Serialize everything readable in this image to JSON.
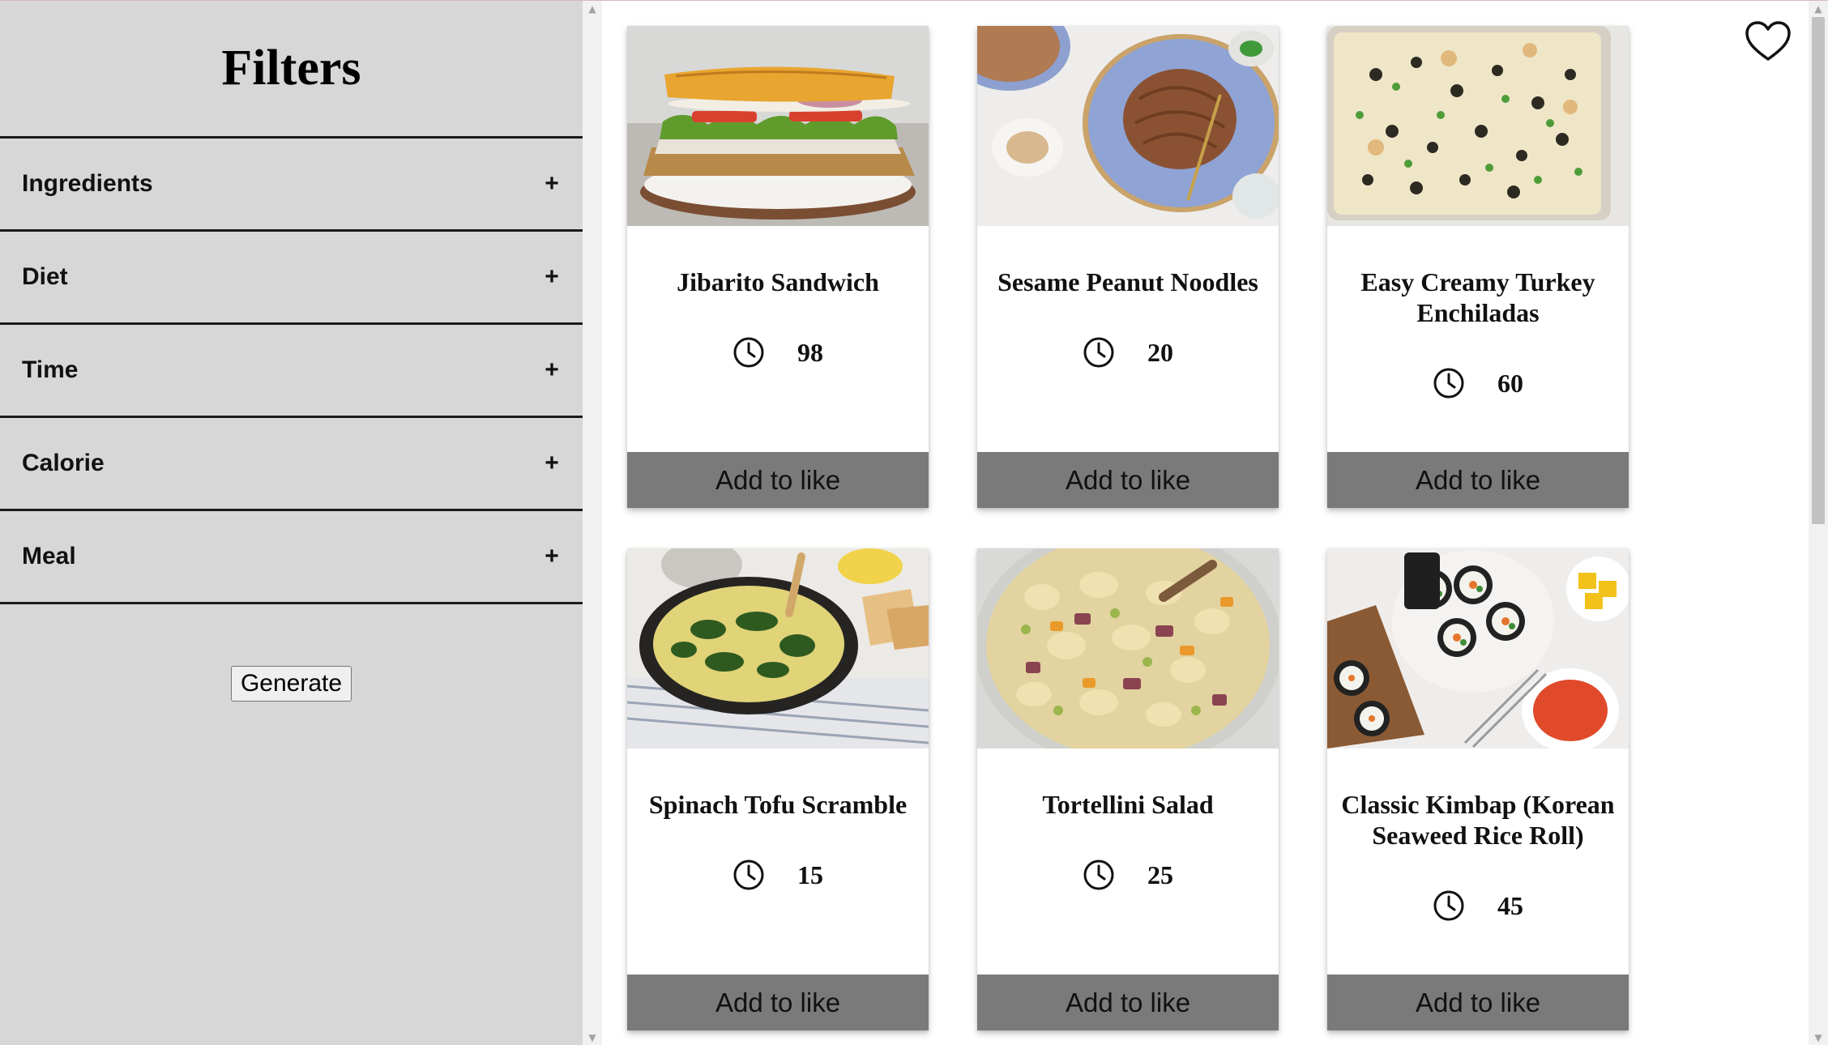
{
  "sidebar": {
    "title": "Filters",
    "filters": [
      {
        "label": "Ingredients",
        "toggle": "+"
      },
      {
        "label": "Diet",
        "toggle": "+"
      },
      {
        "label": "Time",
        "toggle": "+"
      },
      {
        "label": "Calorie",
        "toggle": "+"
      },
      {
        "label": "Meal",
        "toggle": "+"
      }
    ],
    "generate_label": "Generate"
  },
  "favorites_icon": "heart-outline-icon",
  "recipes": [
    {
      "name": "Jibarito Sandwich",
      "time": "98",
      "like_label": "Add to like",
      "icon": "clock-icon"
    },
    {
      "name": "Sesame Peanut Noodles",
      "time": "20",
      "like_label": "Add to like",
      "icon": "clock-icon"
    },
    {
      "name": "Easy Creamy Turkey Enchiladas",
      "time": "60",
      "like_label": "Add to like",
      "icon": "clock-icon"
    },
    {
      "name": "Spinach Tofu Scramble",
      "time": "15",
      "like_label": "Add to like",
      "icon": "clock-icon"
    },
    {
      "name": "Tortellini Salad",
      "time": "25",
      "like_label": "Add to like",
      "icon": "clock-icon"
    },
    {
      "name": "Classic Kimbap (Korean Seaweed Rice Roll)",
      "time": "45",
      "like_label": "Add to like",
      "icon": "clock-icon"
    }
  ],
  "colors": {
    "sidebar_bg": "#d7d7d7",
    "like_button_bg": "#7a7a7a",
    "divider": "#1a1a1a"
  }
}
